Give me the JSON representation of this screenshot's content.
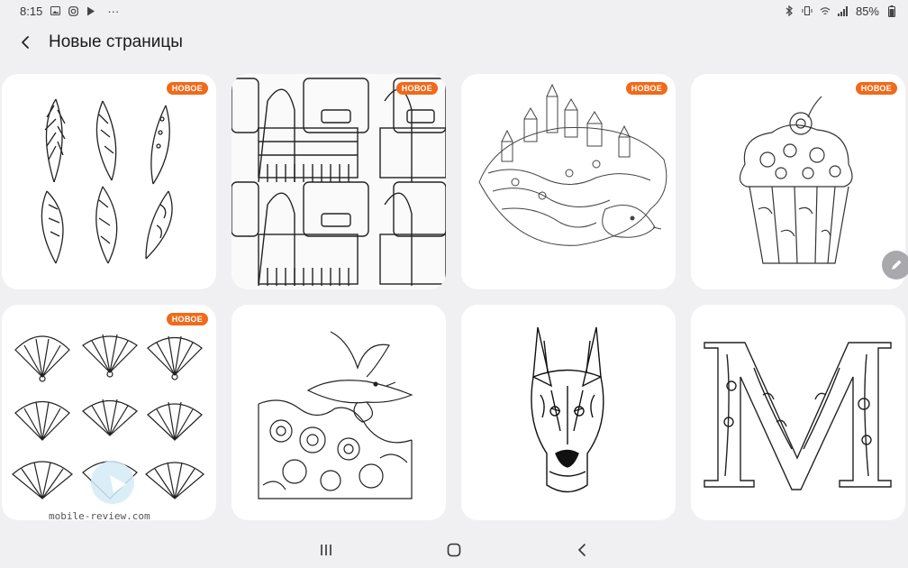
{
  "status": {
    "time": "8:15",
    "more": "···",
    "battery": "85%",
    "left_icons": [
      "gallery-icon",
      "instagram-icon",
      "play-store-icon"
    ],
    "right_icons": [
      "bluetooth-icon",
      "vibrate-icon",
      "wifi-icon",
      "signal-icon",
      "battery-icon"
    ]
  },
  "header": {
    "back_icon": "back-arrow-icon",
    "title": "Новые страницы"
  },
  "cards": [
    {
      "name": "feathers",
      "badge": "НОВОЕ"
    },
    {
      "name": "bags",
      "badge": "НОВОЕ"
    },
    {
      "name": "hedgehog-town",
      "badge": "НОВОЕ"
    },
    {
      "name": "cupcake",
      "badge": "НОВОЕ"
    },
    {
      "name": "fans",
      "badge": "НОВОЕ"
    },
    {
      "name": "bird",
      "badge": ""
    },
    {
      "name": "doberman",
      "badge": ""
    },
    {
      "name": "letter-m",
      "badge": ""
    }
  ],
  "watermark": "mobile-review.com",
  "nav": {
    "recents_icon": "recents-icon",
    "home_icon": "home-icon",
    "back_icon": "nav-back-icon"
  },
  "colors": {
    "badge": "#ef6a1a",
    "background": "#f0f0f2",
    "card": "#ffffff"
  }
}
